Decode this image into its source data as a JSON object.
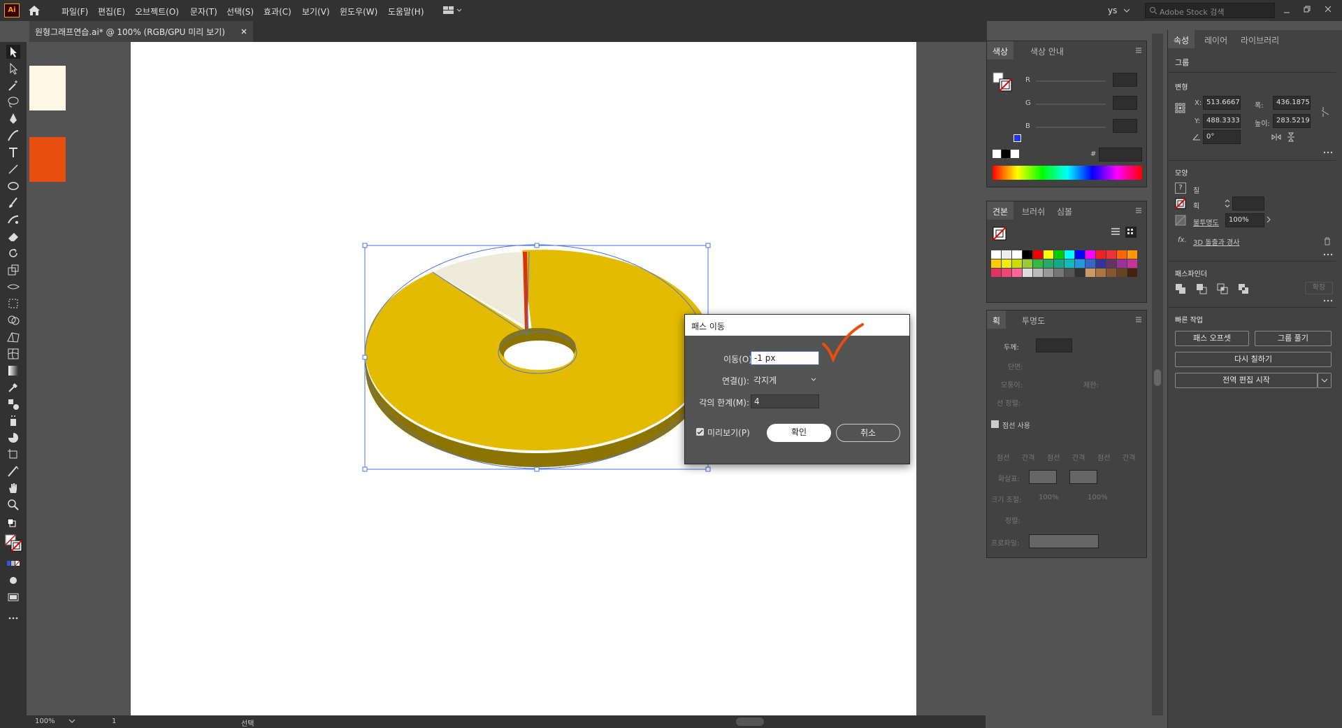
{
  "app": {
    "logo": "Ai"
  },
  "menu": [
    "파일(F)",
    "편집(E)",
    "오브젝트(O)",
    "문자(T)",
    "선택(S)",
    "효과(C)",
    "보기(V)",
    "윈도우(W)",
    "도움말(H)"
  ],
  "topbar": {
    "user": "ys",
    "stock_search_placeholder": "Adobe Stock 검색"
  },
  "document_tab": {
    "label": "원형그래프연습.ai* @ 100% (RGB/GPU 미리 보기)"
  },
  "colors": {
    "cream": "#fff8e7",
    "orange": "#e84e0f",
    "pie_yellow": "#e3bb00",
    "pie_side": "#8c7400",
    "pie_light": "#efebda",
    "pie_red": "#d8350b",
    "selection": "#4a73e8"
  },
  "color_panel": {
    "tabs": [
      "색상",
      "색상 안내"
    ],
    "channels": [
      "R",
      "G",
      "B"
    ],
    "hash": "#"
  },
  "swatches_panel": {
    "tabs": [
      "견본",
      "브러쉬",
      "심볼"
    ]
  },
  "stroke_panel": {
    "tabs": [
      "획",
      "투명도"
    ],
    "weight_label": "두께:",
    "cap_label": "단면:",
    "corner_label": "모퉁이:",
    "limit_label": "제한:",
    "align_label": "선 정렬:",
    "dashed_label": "점선 사용",
    "dash_cols": [
      "점선",
      "간격",
      "점선",
      "간격",
      "점선",
      "간격"
    ],
    "arrow_label": "화살표:",
    "scale_label": "크기 조절:",
    "scale_values": [
      "100%",
      "100%"
    ],
    "align2_label": "정렬:",
    "profile_label": "프로파일:"
  },
  "properties_panel": {
    "tabs": [
      "속성",
      "레이어",
      "라이브러리"
    ],
    "group_label": "그룹",
    "transform_label": "변형",
    "x_label": "X:",
    "x": "513.6667",
    "y_label": "Y:",
    "y": "488.3333",
    "w_label": "폭:",
    "w": "436.1875",
    "h_label": "높이:",
    "h": "283.5219",
    "angle": "0°",
    "appearance_label": "모양",
    "fill_label": "칠",
    "stroke_label": "획",
    "opacity_label": "불투명도",
    "opacity": "100%",
    "effect_label": "3D 돌출과 경사",
    "pathfinder_label": "패스파인더",
    "expand_label": "확장",
    "quick_actions_label": "빠른 작업",
    "offset_path_btn": "패스 오프셋",
    "ungroup_btn": "그룹 풀기",
    "recolor_btn": "다시 칠하기",
    "global_edit_btn": "전역 편집 시작"
  },
  "dialog": {
    "title": "패스 이동",
    "offset_label": "이동(O):",
    "offset_value": "-1 px",
    "joins_label": "연결(J):",
    "joins_value": "각지게",
    "miter_label": "각의 한계(M):",
    "miter_value": "4",
    "preview_label": "미리보기(P)",
    "ok": "확인",
    "cancel": "취소"
  },
  "statusbar": {
    "zoom": "100%",
    "artboard": "1",
    "tool": "선택"
  }
}
